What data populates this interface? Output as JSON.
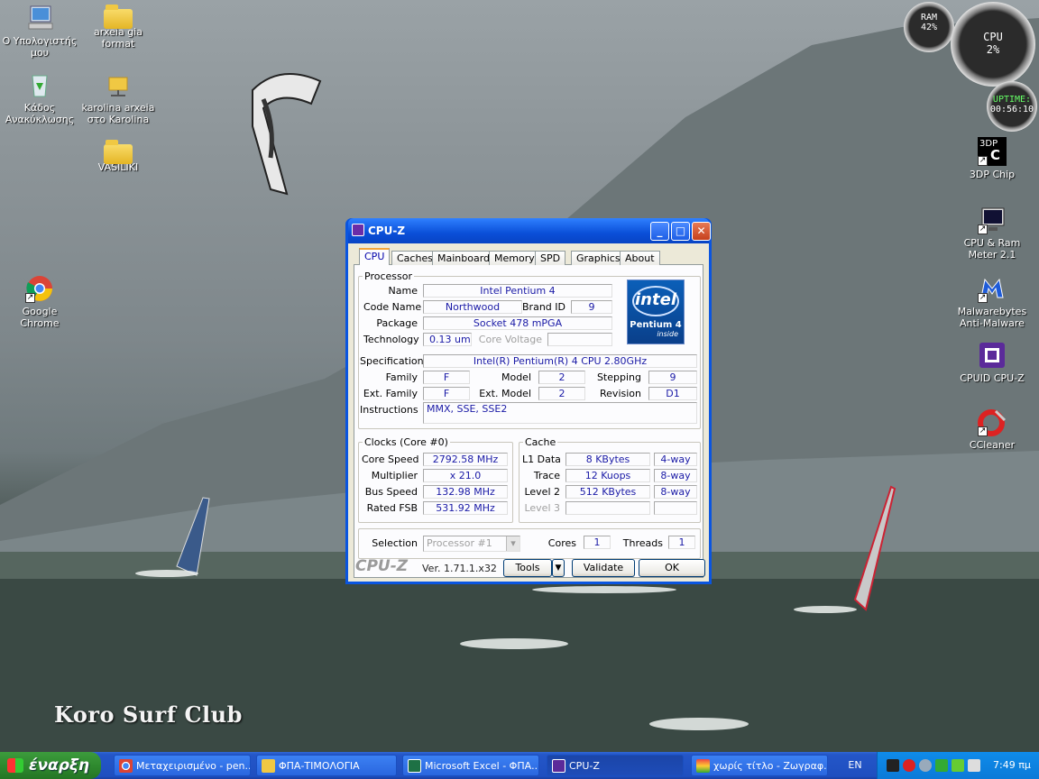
{
  "wallpaper": {
    "brand": "Koro Surf Club"
  },
  "desktop": {
    "icons_left": [
      {
        "label": "Ο Υπολογιστής μου",
        "icon": "my-computer-icon"
      },
      {
        "label": "arxeia gia format",
        "icon": "folder-icon"
      },
      {
        "label": "Κάδος Ανακύκλωσης",
        "icon": "recycle-bin-icon"
      },
      {
        "label": "karolina arxeia στο Karolina",
        "icon": "network-folder-icon"
      },
      {
        "label": "VASILIKI",
        "icon": "folder-icon"
      },
      {
        "label": "Google Chrome",
        "icon": "chrome-icon"
      }
    ],
    "icons_right": [
      {
        "label": "3DP Chip",
        "icon": "3dp-chip-icon"
      },
      {
        "label": "CPU & Ram Meter 2.1",
        "icon": "monitor-icon"
      },
      {
        "label": "Malwarebytes Anti-Malware",
        "icon": "malwarebytes-icon"
      },
      {
        "label": "CPUID CPU-Z",
        "icon": "cpuz-icon"
      },
      {
        "label": "CCleaner",
        "icon": "ccleaner-icon"
      }
    ]
  },
  "gadgets": {
    "ram_label": "RAM",
    "ram_value": "42%",
    "cpu_label": "CPU",
    "cpu_value": "2%",
    "uptime_label": "UPTIME:",
    "uptime_value": "00:56:10"
  },
  "window": {
    "title": "CPU-Z",
    "tabs": [
      "CPU",
      "Caches",
      "Mainboard",
      "Memory",
      "SPD",
      "Graphics",
      "About"
    ],
    "active_tab": "CPU",
    "processor": {
      "legend": "Processor",
      "name_label": "Name",
      "name": "Intel Pentium 4",
      "codename_label": "Code Name",
      "codename": "Northwood",
      "brandid_label": "Brand ID",
      "brandid": "9",
      "package_label": "Package",
      "package": "Socket 478 mPGA",
      "technology_label": "Technology",
      "technology": "0.13 um",
      "corevoltage_label": "Core Voltage",
      "corevoltage": "",
      "spec_label": "Specification",
      "spec": "Intel(R) Pentium(R) 4 CPU 2.80GHz",
      "family_label": "Family",
      "family": "F",
      "model_label": "Model",
      "model": "2",
      "stepping_label": "Stepping",
      "stepping": "9",
      "extfamily_label": "Ext. Family",
      "extfamily": "F",
      "extmodel_label": "Ext. Model",
      "extmodel": "2",
      "revision_label": "Revision",
      "revision": "D1",
      "instructions_label": "Instructions",
      "instructions": "MMX, SSE, SSE2",
      "logo_brand": "intel",
      "logo_product": "Pentium 4",
      "logo_inside": "inside"
    },
    "clocks": {
      "legend": "Clocks (Core #0)",
      "corespeed_label": "Core Speed",
      "corespeed": "2792.58 MHz",
      "multiplier_label": "Multiplier",
      "multiplier": "x 21.0",
      "busspeed_label": "Bus Speed",
      "busspeed": "132.98 MHz",
      "ratedfsb_label": "Rated FSB",
      "ratedfsb": "531.92 MHz"
    },
    "cache": {
      "legend": "Cache",
      "l1_label": "L1 Data",
      "l1": "8 KBytes",
      "l1_way": "4-way",
      "trace_label": "Trace",
      "trace": "12 Kuops",
      "trace_way": "8-way",
      "l2_label": "Level 2",
      "l2": "512 KBytes",
      "l2_way": "8-way",
      "l3_label": "Level 3",
      "l3": "",
      "l3_way": ""
    },
    "selection": {
      "selection_label": "Selection",
      "selection": "Processor #1",
      "cores_label": "Cores",
      "cores": "1",
      "threads_label": "Threads",
      "threads": "1"
    },
    "footer": {
      "logo": "CPU-Z",
      "version": "Ver. 1.71.1.x32",
      "tools": "Tools",
      "validate": "Validate",
      "ok": "OK"
    }
  },
  "taskbar": {
    "start": "έναρξη",
    "tasks": [
      {
        "label": "Μεταχειρισμένο - pen...",
        "icon": "chrome-icon"
      },
      {
        "label": "ΦΠΑ-ΤΙΜΟΛΟΓΙΑ",
        "icon": "folder-icon"
      },
      {
        "label": "Microsoft Excel - ΦΠΑ...",
        "icon": "excel-icon"
      },
      {
        "label": "CPU-Z",
        "icon": "cpuz-icon"
      },
      {
        "label": "χωρίς τίτλο - Ζωγραφ...",
        "icon": "paint-icon"
      }
    ],
    "lang": "EN",
    "clock": "7:49 πμ"
  }
}
